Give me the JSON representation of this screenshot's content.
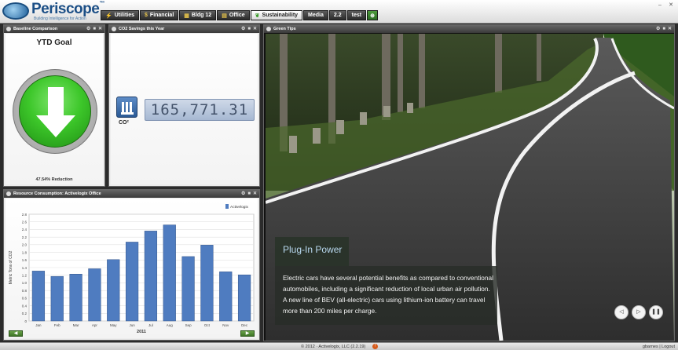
{
  "app": {
    "name": "Periscope",
    "tagline": "Building Intelligence for Action"
  },
  "tabs": [
    {
      "label": "Utilities",
      "icon": "lightning-icon"
    },
    {
      "label": "Financial",
      "icon": "dollar-icon"
    },
    {
      "label": "Bldg 12",
      "icon": "building-icon"
    },
    {
      "label": "Office",
      "icon": "office-icon"
    },
    {
      "label": "Sustainability",
      "icon": "leaf-icon",
      "active": true
    },
    {
      "label": "Media",
      "icon": ""
    },
    {
      "label": "2.2",
      "icon": ""
    },
    {
      "label": "test",
      "icon": ""
    }
  ],
  "panels": {
    "baseline": {
      "title": "Baseline Comparison",
      "goal_title": "YTD Goal",
      "reduction_text": "47.54% Reduction"
    },
    "co2": {
      "title": "CO2 Savings this Year",
      "value": "165,771.31",
      "unit_label": "CO²"
    },
    "resource": {
      "title": "Resource Consumption: Activelogix Office"
    },
    "green": {
      "title": "Green Tips",
      "tip_title": "Plug-In Power",
      "tip_body": "Electric cars have several potential benefits as compared to conventional automobiles, including a significant reduction of local urban air pollution. A new line of BEV (all-electric) cars using lithium-ion battery can travel more than 200 miles per charge."
    }
  },
  "chart_data": {
    "type": "bar",
    "categories": [
      "Jan",
      "Feb",
      "Mar",
      "Apr",
      "May",
      "Jun",
      "Jul",
      "Aug",
      "Sep",
      "Oct",
      "Nov",
      "Dec"
    ],
    "series": [
      {
        "name": "Activelogix",
        "values": [
          1.31,
          1.17,
          1.23,
          1.37,
          1.61,
          2.07,
          2.36,
          2.52,
          1.69,
          1.99,
          1.29,
          1.21
        ],
        "color": "#4f7cc0"
      }
    ],
    "yticks": [
      "0",
      "0.2",
      "0.4",
      "0.6",
      "0.8",
      "1.0",
      "1.2",
      "1.4",
      "1.6",
      "1.8",
      "2.0",
      "2.2",
      "2.4",
      "2.6",
      "2.8"
    ],
    "ylim": [
      0,
      2.8
    ],
    "xlabel": "2011",
    "ylabel": "Metric Tons of CO2",
    "legend_position": "top-right",
    "grid": true
  },
  "footer": {
    "copyright": "© 2012 · Activelogix, LLC (2.2.19)",
    "user_links": "gbarnes | Logout"
  },
  "colors": {
    "accent_green": "#3dc72a",
    "bar_blue": "#4f7cc0",
    "brand_blue": "#1c4f86"
  }
}
